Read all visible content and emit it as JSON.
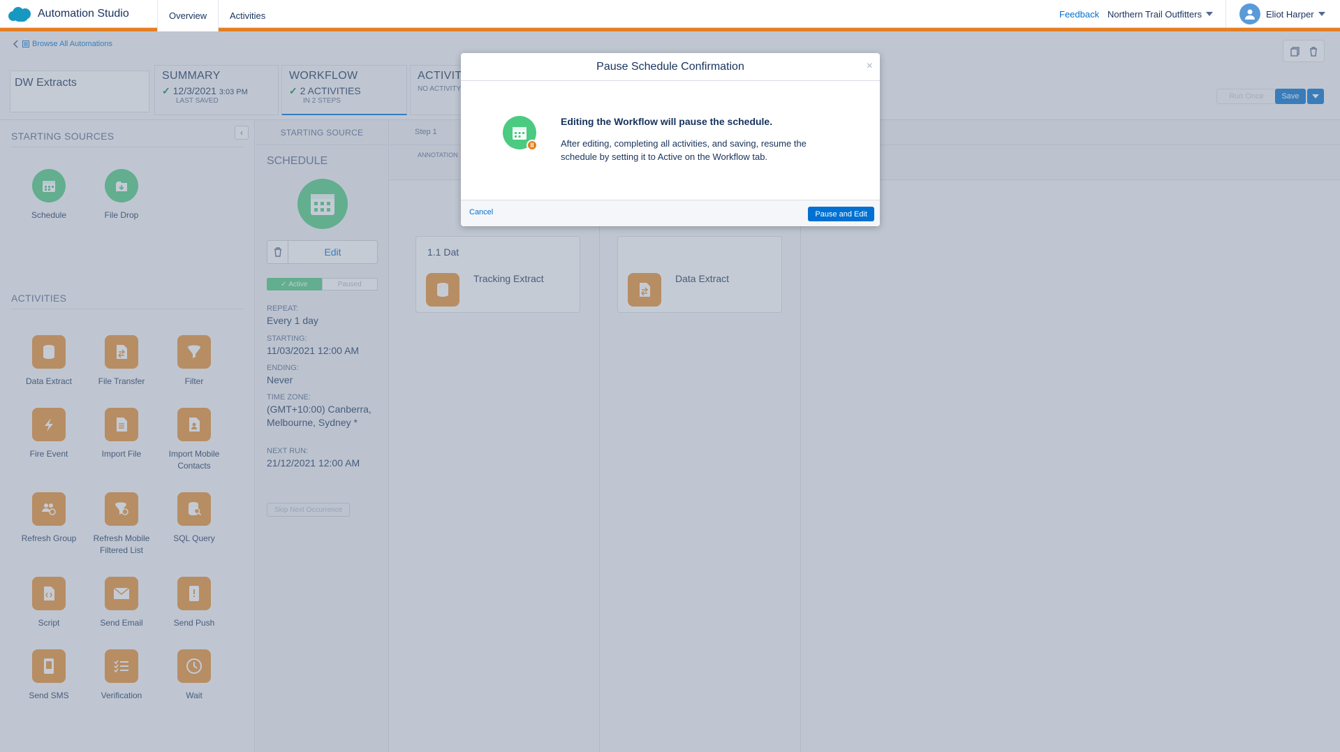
{
  "header": {
    "app_title": "Automation Studio",
    "tabs": [
      {
        "label": "Overview",
        "active": true
      },
      {
        "label": "Activities",
        "active": false
      }
    ],
    "feedback": "Feedback",
    "org": "Northern Trail Outfitters",
    "user": "Eliot Harper"
  },
  "breadcrumb": "Browse All Automations",
  "automation_name": "DW Extracts",
  "summary": {
    "label": "SUMMARY",
    "date": "12/3/2021",
    "time": "3:03 PM",
    "sub": "LAST SAVED"
  },
  "workflow": {
    "label": "WORKFLOW",
    "value": "2 ACTIVITIES",
    "sub": "IN 2 STEPS"
  },
  "activity": {
    "label": "ACTIVITY",
    "sub": "NO ACTIVITY"
  },
  "buttons": {
    "run_once": "Run Once",
    "save": "Save"
  },
  "left_panel": {
    "starting_sources_title": "STARTING SOURCES",
    "starting_sources": [
      {
        "label": "Schedule",
        "icon": "calendar-icon"
      },
      {
        "label": "File Drop",
        "icon": "file-drop-icon"
      }
    ],
    "activities_title": "ACTIVITIES",
    "activities": [
      {
        "label": "Data Extract",
        "icon": "data-extract-icon"
      },
      {
        "label": "File Transfer",
        "icon": "file-transfer-icon"
      },
      {
        "label": "Filter",
        "icon": "filter-icon"
      },
      {
        "label": "Fire Event",
        "icon": "lightning-icon"
      },
      {
        "label": "Import File",
        "icon": "import-file-icon"
      },
      {
        "label": "Import Mobile Contacts",
        "icon": "import-contacts-icon"
      },
      {
        "label": "Refresh Group",
        "icon": "refresh-group-icon"
      },
      {
        "label": "Refresh Mobile Filtered List",
        "icon": "refresh-list-icon"
      },
      {
        "label": "SQL Query",
        "icon": "sql-query-icon"
      },
      {
        "label": "Script",
        "icon": "script-icon"
      },
      {
        "label": "Send Email",
        "icon": "email-icon"
      },
      {
        "label": "Send Push",
        "icon": "push-icon"
      },
      {
        "label": "Send SMS",
        "icon": "sms-icon"
      },
      {
        "label": "Verification",
        "icon": "verification-icon"
      },
      {
        "label": "Wait",
        "icon": "clock-icon"
      }
    ]
  },
  "schedule_col": {
    "header": "STARTING SOURCE",
    "title": "SCHEDULE",
    "edit": "Edit",
    "toggle_active": "Active",
    "toggle_paused": "Paused",
    "repeat_label": "REPEAT:",
    "repeat_value": "Every 1 day",
    "starting_label": "STARTING:",
    "starting_value": "11/03/2021 12:00 AM",
    "ending_label": "ENDING:",
    "ending_value": "Never",
    "tz_label": "TIME ZONE:",
    "tz_value": "(GMT+10:00) Canberra, Melbourne, Sydney *",
    "next_label": "NEXT RUN:",
    "next_value": "21/12/2021 12:00 AM",
    "skip": "Skip Next Occurrence"
  },
  "steps": {
    "step1_label": "Step 1",
    "annotation": "ANNOTATION",
    "card1_header": "1.1 Dat",
    "card1_name": "Tracking Extract",
    "card2_name": "Data Extract"
  },
  "modal": {
    "title": "Pause Schedule Confirmation",
    "close": "×",
    "heading": "Editing the Workflow will pause the schedule.",
    "body": "After editing, completing all activities, and saving, resume the schedule by setting it to Active on the Workflow tab.",
    "cancel": "Cancel",
    "confirm": "Pause and Edit"
  },
  "colors": {
    "accent": "#0070d2",
    "orange": "#e67e22",
    "green": "#4bca81",
    "activity_orange": "#e58f33"
  }
}
